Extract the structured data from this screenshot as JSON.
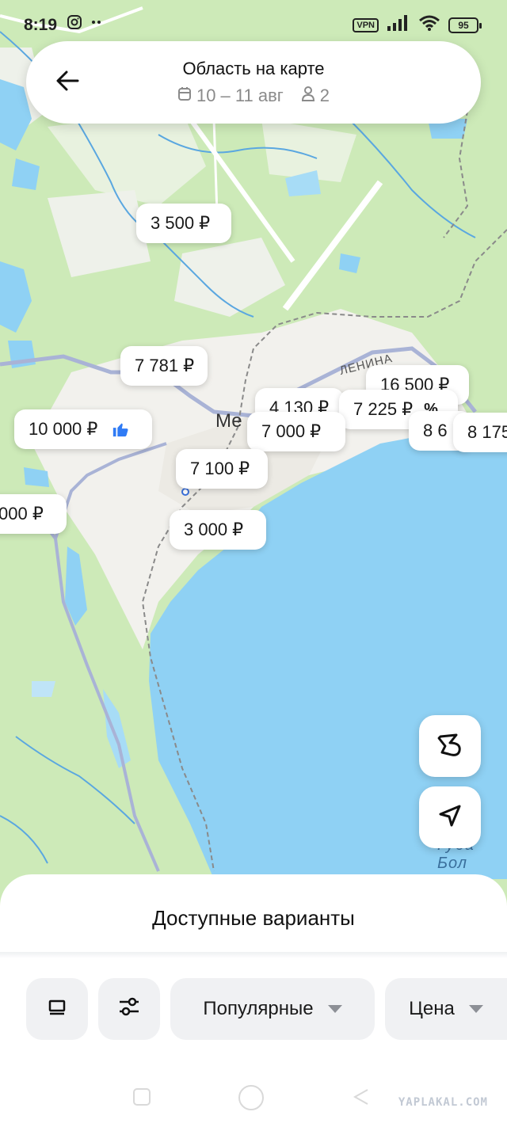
{
  "status_bar": {
    "time": "8:19",
    "vpn": "VPN",
    "battery": "95",
    "icons": [
      "instagram-icon",
      "more-dots-icon",
      "signal-icon",
      "wifi-icon"
    ]
  },
  "header": {
    "title": "Область на карте",
    "dates": "10 – 11 авг",
    "guests": "2",
    "icons": [
      "back-arrow-icon",
      "calendar-icon",
      "person-icon"
    ]
  },
  "map": {
    "street_label": "ЛЕНИНА",
    "town_label": "Ме",
    "sea_label": "Губа Бол",
    "colors": {
      "land": "#cdeab8",
      "urban": "#f2f1ed",
      "water": "#8fd1f4",
      "road": "#a9b3d6",
      "rail": "#9a9a9a"
    }
  },
  "price_pins": [
    {
      "id": "p3500",
      "text": "3 500 ₽"
    },
    {
      "id": "p7781",
      "text": "7 781 ₽"
    },
    {
      "id": "p10000",
      "text": "10 000 ₽",
      "badge": "thumbs-up-icon"
    },
    {
      "id": "pedge",
      "text": "000 ₽"
    },
    {
      "id": "p16500",
      "text": "16 500 ₽"
    },
    {
      "id": "p4130",
      "text": "4 130 ₽"
    },
    {
      "id": "p7225",
      "text": "7 225 ₽",
      "suffix": "%"
    },
    {
      "id": "p7000",
      "text": "7 000 ₽"
    },
    {
      "id": "p86",
      "text": "8 6"
    },
    {
      "id": "p8175",
      "text": "8 175"
    },
    {
      "id": "p7100",
      "text": "7 100 ₽"
    },
    {
      "id": "p3000",
      "text": "3 000 ₽"
    }
  ],
  "map_buttons": [
    "draw-area-icon",
    "navigate-arrow-icon"
  ],
  "sheet": {
    "title": "Доступные варианты",
    "chips": {
      "popular": "Популярные",
      "price": "Цена"
    },
    "chip_icons": [
      "list-view-icon",
      "filter-sliders-icon"
    ]
  },
  "nav": {
    "watermark": "YAPLAKAL.COM",
    "icons": [
      "recent-apps-icon",
      "home-icon",
      "back-icon"
    ]
  }
}
